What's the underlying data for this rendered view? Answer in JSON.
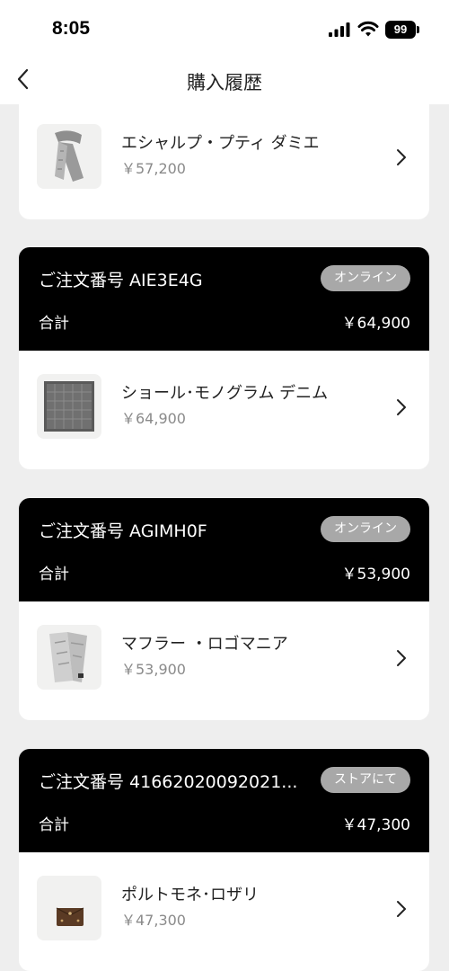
{
  "status_bar": {
    "time": "8:05",
    "battery": "99"
  },
  "nav": {
    "title": "購入履歴"
  },
  "first_item": {
    "name": "エシャルプ・プティ ダミエ",
    "price": "￥57,200"
  },
  "orders": [
    {
      "order_no": "ご注文番号 AIE3E4G",
      "channel": "オンライン",
      "total_label": "合計",
      "total": "￥64,900",
      "item": {
        "name": "ショール･モノグラム デニム",
        "price": "￥64,900"
      }
    },
    {
      "order_no": "ご注文番号 AGIMH0F",
      "channel": "オンライン",
      "total_label": "合計",
      "total": "￥53,900",
      "item": {
        "name": "マフラー ・ロゴマニア",
        "price": "￥53,900"
      }
    },
    {
      "order_no": "ご注文番号 41662020092021...",
      "channel": "ストアにて",
      "total_label": "合計",
      "total": "￥47,300",
      "item": {
        "name": "ポルトモネ･ロザリ",
        "price": "￥47,300"
      }
    }
  ],
  "icons": {
    "back": "chevron-left-icon",
    "row": "chevron-right-icon"
  },
  "colors": {
    "header": "#000000",
    "badge": "#a8a8a8",
    "background": "#eeeeee"
  }
}
